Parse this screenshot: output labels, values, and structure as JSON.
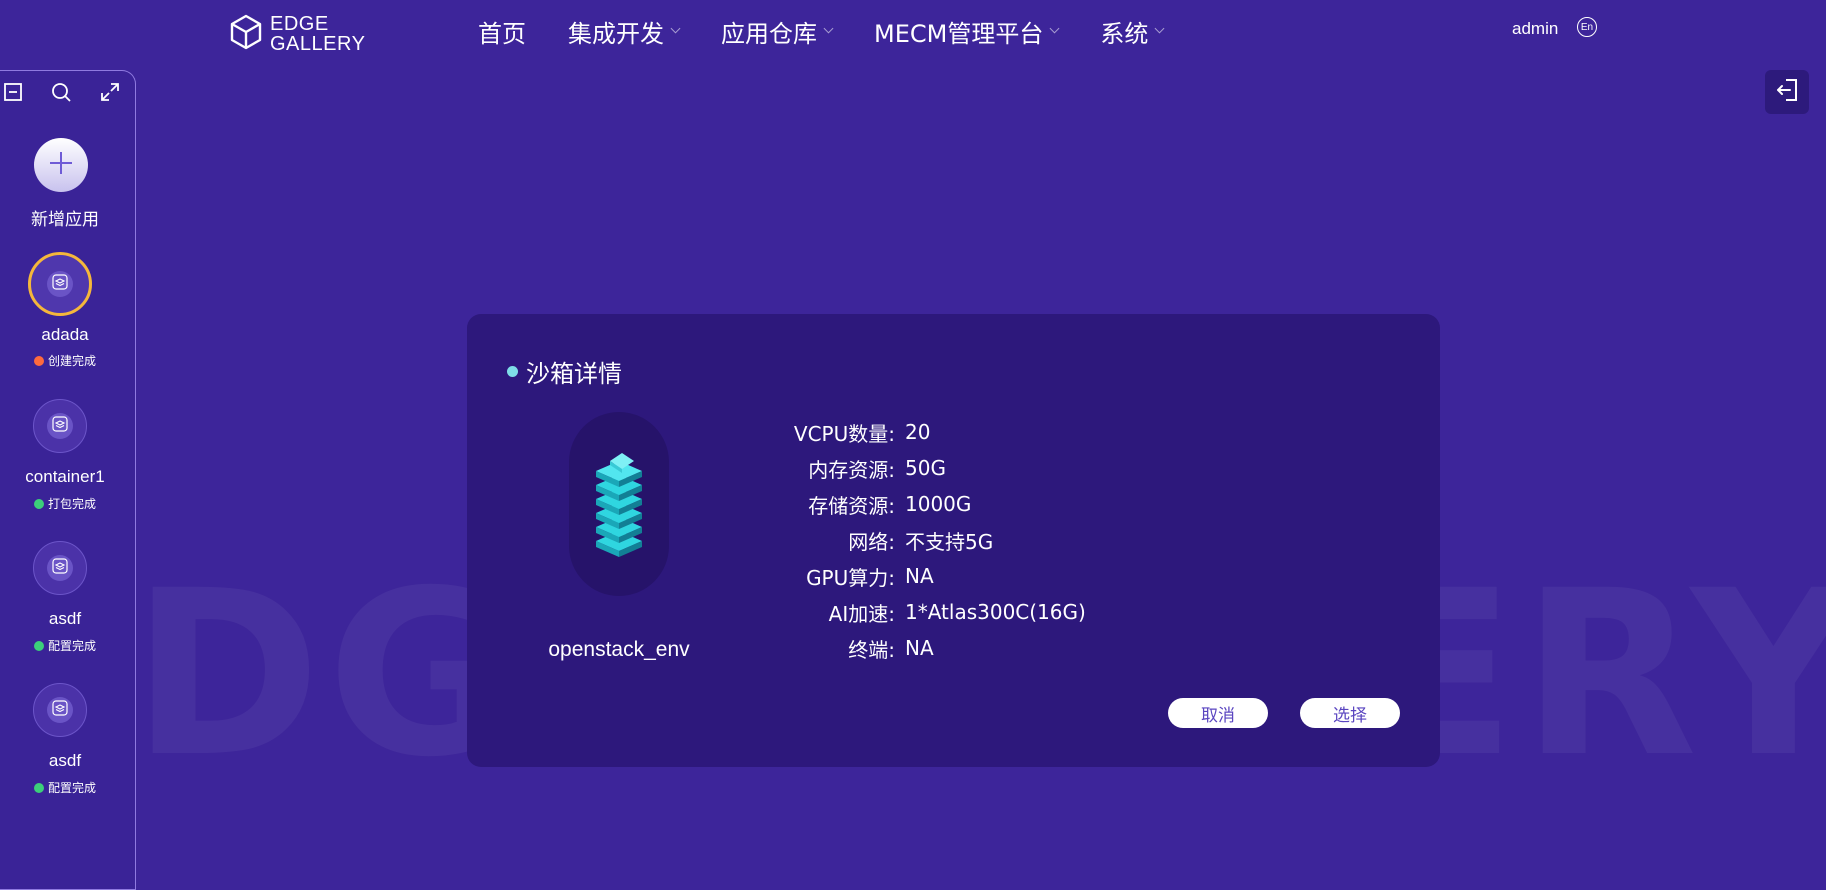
{
  "watermark": "EDGEGALLERY",
  "header": {
    "logo_line1": "EDGE",
    "logo_line2": "GALLERY",
    "nav": [
      {
        "label": "首页"
      },
      {
        "label": "集成开发"
      },
      {
        "label": "应用仓库"
      },
      {
        "label": "MECM管理平台"
      },
      {
        "label": "系统"
      }
    ],
    "user": "admin",
    "lang": "En"
  },
  "sidebar": {
    "add_label": "新增应用",
    "apps": [
      {
        "name": "adada",
        "status": "创建完成",
        "status_color": "#ff6a3d"
      },
      {
        "name": "container1",
        "status": "打包完成",
        "status_color": "#3ccf7a"
      },
      {
        "name": "asdf",
        "status": "配置完成",
        "status_color": "#3ccf7a"
      },
      {
        "name": "asdf",
        "status": "配置完成",
        "status_color": "#3ccf7a"
      }
    ]
  },
  "dialog": {
    "title": "沙箱详情",
    "env_name": "openstack_env",
    "details": [
      {
        "key": "VCPU数量:",
        "value": "20"
      },
      {
        "key": "内存资源:",
        "value": "50G"
      },
      {
        "key": "存储资源:",
        "value": "1000G"
      },
      {
        "key": "网络:",
        "value": "不支持5G"
      },
      {
        "key": "GPU算力:",
        "value": "NA"
      },
      {
        "key": "AI加速:",
        "value": "1*Atlas300C(16G)"
      },
      {
        "key": "终端:",
        "value": "NA"
      }
    ],
    "cancel_label": "取消",
    "select_label": "选择"
  }
}
